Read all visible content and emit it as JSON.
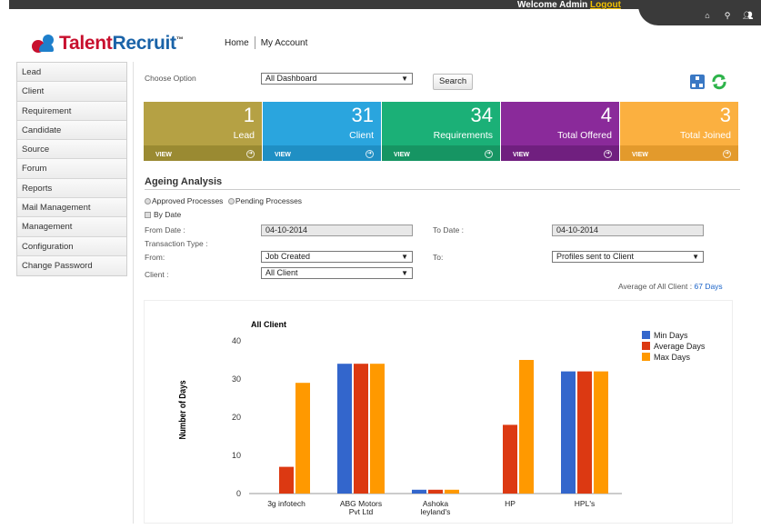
{
  "topbar": {
    "welcome": "Welcome Admin",
    "logout": "Logout"
  },
  "logo": {
    "part1": "Talent",
    "part2": "Recruit",
    "tm": "™"
  },
  "topnav": {
    "home": "Home",
    "account": "My Account"
  },
  "sidebar": {
    "items": [
      {
        "label": "Lead"
      },
      {
        "label": "Client"
      },
      {
        "label": "Requirement"
      },
      {
        "label": "Candidate"
      },
      {
        "label": "Source"
      },
      {
        "label": "Forum"
      },
      {
        "label": "Reports"
      },
      {
        "label": "Mail Management"
      },
      {
        "label": "Management"
      },
      {
        "label": "Configuration"
      },
      {
        "label": "Change Password"
      }
    ]
  },
  "dashboard": {
    "choose_label": "Choose Option",
    "choose_value": "All Dashboard",
    "search_label": "Search"
  },
  "tiles": [
    {
      "num": "1",
      "name": "Lead",
      "view": "VIEW",
      "color": "#b5a144",
      "foot": "#9a8a32"
    },
    {
      "num": "31",
      "name": "Client",
      "view": "VIEW",
      "color": "#2aa5de",
      "foot": "#1f8fc4"
    },
    {
      "num": "34",
      "name": "Requirements",
      "view": "VIEW",
      "color": "#1bb077",
      "foot": "#169563"
    },
    {
      "num": "4",
      "name": "Total Offered",
      "view": "VIEW",
      "color": "#8a2a9a",
      "foot": "#701f7f"
    },
    {
      "num": "3",
      "name": "Total Joined",
      "view": "VIEW",
      "color": "#fbb040",
      "foot": "#e39a2c"
    }
  ],
  "ageing": {
    "title": "Ageing Analysis",
    "radio1": "Approved Processes",
    "radio2": "Pending Processes",
    "bydate": "By Date",
    "from_date_label": "From Date :",
    "from_date_value": "04-10-2014",
    "to_date_label": "To Date :",
    "to_date_value": "04-10-2014",
    "txn_label": "Transaction Type :",
    "from_label": "From:",
    "from_value": "Job Created",
    "to_label": "To:",
    "to_value": "Profiles sent to Client",
    "client_label": "Client :",
    "client_value": "All Client",
    "avg_label": "Average of All Client :",
    "avg_value": "67 Days"
  },
  "chart_data": {
    "type": "bar",
    "title": "All Client",
    "ylabel": "Number of Days",
    "xlabel": "",
    "ylim": [
      0,
      40
    ],
    "yticks": [
      0,
      10,
      20,
      30,
      40
    ],
    "categories": [
      [
        "3g infotech"
      ],
      [
        "ABG Motors",
        "Pvt Ltd"
      ],
      [
        "Ashoka",
        "leyland's"
      ],
      [
        "HP"
      ],
      [
        "HPL's"
      ]
    ],
    "series": [
      {
        "name": "Min Days",
        "color": "#3366cc",
        "values": [
          0,
          34,
          1,
          0,
          32
        ]
      },
      {
        "name": "Average Days",
        "color": "#dc3912",
        "values": [
          7,
          34,
          1,
          18,
          32
        ]
      },
      {
        "name": "Max Days",
        "color": "#ff9900",
        "values": [
          29,
          34,
          1,
          35,
          32
        ]
      }
    ],
    "legend": "right"
  }
}
